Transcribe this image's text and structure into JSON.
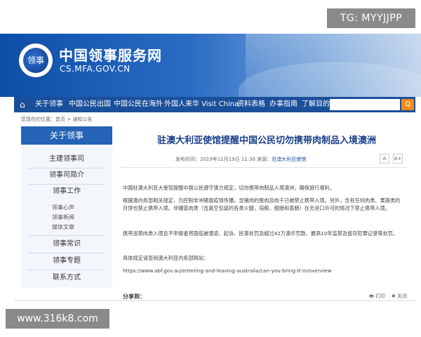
{
  "watermarks": {
    "top": "TG: MYYJJPP",
    "bottom": "www.316k8.com"
  },
  "header": {
    "title": "中国领事服务网",
    "url": "CS.MFA.GOV.CN",
    "logo_text": "领事"
  },
  "nav": {
    "items": [
      "关于领事",
      "中国公民出国",
      "中国公民在海外",
      "外国人来华 Visit China",
      "资料表格",
      "办事指南",
      "了解目的地"
    ],
    "search_button": "Q"
  },
  "breadcrumb": "您现在的位置：首页 > 通知公告",
  "sidebar": {
    "title": "关于领事",
    "items": [
      "主建领事司",
      "领事司简介",
      "领事工作",
      "领事常识",
      "领事专题",
      "联系方式"
    ],
    "subitems": [
      "领事心声",
      "领事新闻",
      "媒体文章"
    ]
  },
  "article": {
    "title": "驻澳大利亚使馆提醒中国公民切勿携带肉制品入境澳洲",
    "meta_prefix": "发布时间：2019年11月19日  11:36  来源：",
    "meta_source": "驻澳大利亚使馆",
    "font_small": "A",
    "font_large": "A+",
    "paragraphs": [
      "中国驻澳大利亚大使馆提醒中国公民遵守澳方规定，切勿携带肉制品入境澳洲，确保旅行顺利。",
      "根据澳内务部相关规定，为控制非洲猪瘟疫情传播，含猪肉的蛋肉及肉干已被禁止携带入境。另外，含有任何肉类、果蔬类的月饼也禁止携带入境。非罐装肉类（含真空包装的各类火腿，培根，腊肠和香肠）在无进口许可的情况下禁止携带入境。",
      "携带违禁肉类入境且不申报者将面临被遣返、起诉、民事处罚及超过42万澳币罚款、最高10年监禁及留存犯罪记录等处罚。",
      "具体规定请查阅澳大利亚内务部网站：",
      "https://www.abf.gov.au/entering-and-leaving-australia/can-you-bring-it-in/overview"
    ],
    "share_label": "分享到：",
    "print_label": "打印",
    "close_label": "关闭"
  }
}
